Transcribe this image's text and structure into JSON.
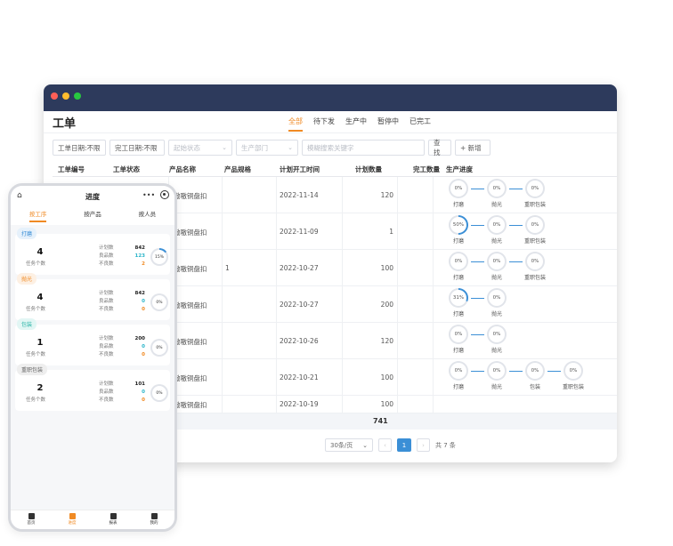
{
  "desktop": {
    "page_title": "工单",
    "tabs": [
      "全部",
      "待下发",
      "生产中",
      "暂停中",
      "已完工"
    ],
    "filters": {
      "work_date": "工单日期:不限",
      "finish_date": "完工日期:不限",
      "status_placeholder": "起始状态",
      "dept_placeholder": "生产部门",
      "search_placeholder": "模糊搜索关键字",
      "query_label": "查找",
      "add_label": "+ 新增"
    },
    "columns": [
      "工单编号",
      "工单状态",
      "产品名称",
      "产品规格",
      "计划开工时间",
      "计划数量",
      "完工数量",
      "生产进度"
    ],
    "rows": [
      {
        "product": "(嗷嗷铜盘扣",
        "spec": "",
        "date": "2022-11-14",
        "qty": "120",
        "steps": [
          {
            "pct": "0%",
            "name": "打磨"
          },
          {
            "pct": "0%",
            "name": "抛光"
          },
          {
            "pct": "0%",
            "name": "重职包装"
          }
        ]
      },
      {
        "product": "(嗷嗷铜盘扣",
        "spec": "",
        "date": "2022-11-09",
        "qty": "1",
        "steps": [
          {
            "pct": "50%",
            "name": "打磨"
          },
          {
            "pct": "0%",
            "name": "抛光"
          },
          {
            "pct": "0%",
            "name": "重职包装"
          }
        ]
      },
      {
        "product": "(嗷嗷铜盘扣",
        "spec": "1",
        "date": "2022-10-27",
        "qty": "100",
        "steps": [
          {
            "pct": "0%",
            "name": "打磨"
          },
          {
            "pct": "0%",
            "name": "抛光"
          },
          {
            "pct": "0%",
            "name": "重职包装"
          }
        ]
      },
      {
        "product": "(嗷嗷铜盘扣",
        "spec": "",
        "date": "2022-10-27",
        "qty": "200",
        "steps": [
          {
            "pct": "31%",
            "name": "打磨"
          },
          {
            "pct": "0%",
            "name": "抛光"
          }
        ]
      },
      {
        "product": "(嗷嗷铜盘扣",
        "spec": "",
        "date": "2022-10-26",
        "qty": "120",
        "steps": [
          {
            "pct": "0%",
            "name": "打磨"
          },
          {
            "pct": "0%",
            "name": "抛光"
          }
        ]
      },
      {
        "product": "(嗷嗷铜盘扣",
        "spec": "",
        "date": "2022-10-21",
        "qty": "100",
        "steps": [
          {
            "pct": "0%",
            "name": "打磨"
          },
          {
            "pct": "0%",
            "name": "抛光"
          },
          {
            "pct": "0%",
            "name": "包装"
          },
          {
            "pct": "0%",
            "name": "重职包装"
          }
        ]
      },
      {
        "product": "(嗷嗷铜盘扣",
        "spec": "",
        "date": "2022-10-19",
        "qty": "100",
        "steps": []
      }
    ],
    "total": "741",
    "pager": {
      "size": "30条/页",
      "current": "1",
      "total_text": "共 7 条"
    }
  },
  "phone": {
    "title": "进度",
    "tabs": [
      "按工序",
      "按产品",
      "按人员"
    ],
    "cards": [
      {
        "badge": "打磨",
        "badge_color": "#3b8fd6",
        "badge_bg": "#e6f1fb",
        "count": "4",
        "sub": "任务个数",
        "plan": "842",
        "good": "123",
        "bad": "2",
        "pct": "15%",
        "fill": 0.15
      },
      {
        "badge": "抛光",
        "badge_color": "#f08a24",
        "badge_bg": "#fdf0e3",
        "count": "4",
        "sub": "任务个数",
        "plan": "842",
        "good": "0",
        "bad": "0",
        "pct": "0%",
        "fill": 0
      },
      {
        "badge": "包装",
        "badge_color": "#2bb5a8",
        "badge_bg": "#e2f6f4",
        "count": "1",
        "sub": "任务个数",
        "plan": "200",
        "good": "0",
        "bad": "0",
        "pct": "0%",
        "fill": 0
      },
      {
        "badge": "重职包装",
        "badge_color": "#666666",
        "badge_bg": "#eeeeee",
        "count": "2",
        "sub": "任务个数",
        "plan": "101",
        "good": "0",
        "bad": "0",
        "pct": "0%",
        "fill": 0
      }
    ],
    "labels": {
      "plan": "计划数",
      "good": "良品数",
      "bad": "不良数"
    },
    "nav": [
      {
        "label": "首页"
      },
      {
        "label": "进度"
      },
      {
        "label": "报表"
      },
      {
        "label": "我的"
      }
    ]
  }
}
